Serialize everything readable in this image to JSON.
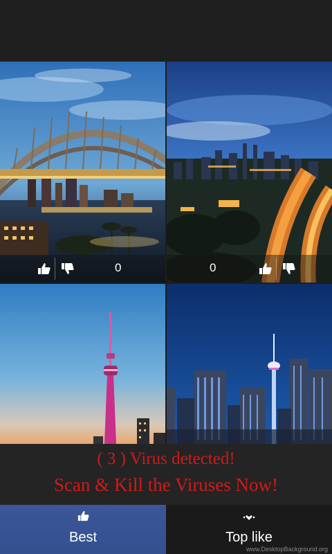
{
  "tiles": [
    {
      "id": "sydney",
      "likes": "0",
      "has_votes": true
    },
    {
      "id": "kl-highway",
      "likes": "0",
      "has_votes": true
    },
    {
      "id": "cn-tower",
      "has_votes": false
    },
    {
      "id": "kl-tower",
      "has_votes": false
    }
  ],
  "alert": {
    "line1": "( 3 )  Virus detected!",
    "line2": "Scan & Kill the Viruses Now!"
  },
  "tabs": [
    {
      "label": "Best",
      "icon": "thumbs-up-icon",
      "selected": true
    },
    {
      "label": "Top like",
      "icon": "hearts-icon",
      "selected": false
    }
  ],
  "watermark": "www.DesktopBackground.org",
  "colors": {
    "alert_text": "#d11a1a",
    "tab_selected": "#3b5699"
  }
}
